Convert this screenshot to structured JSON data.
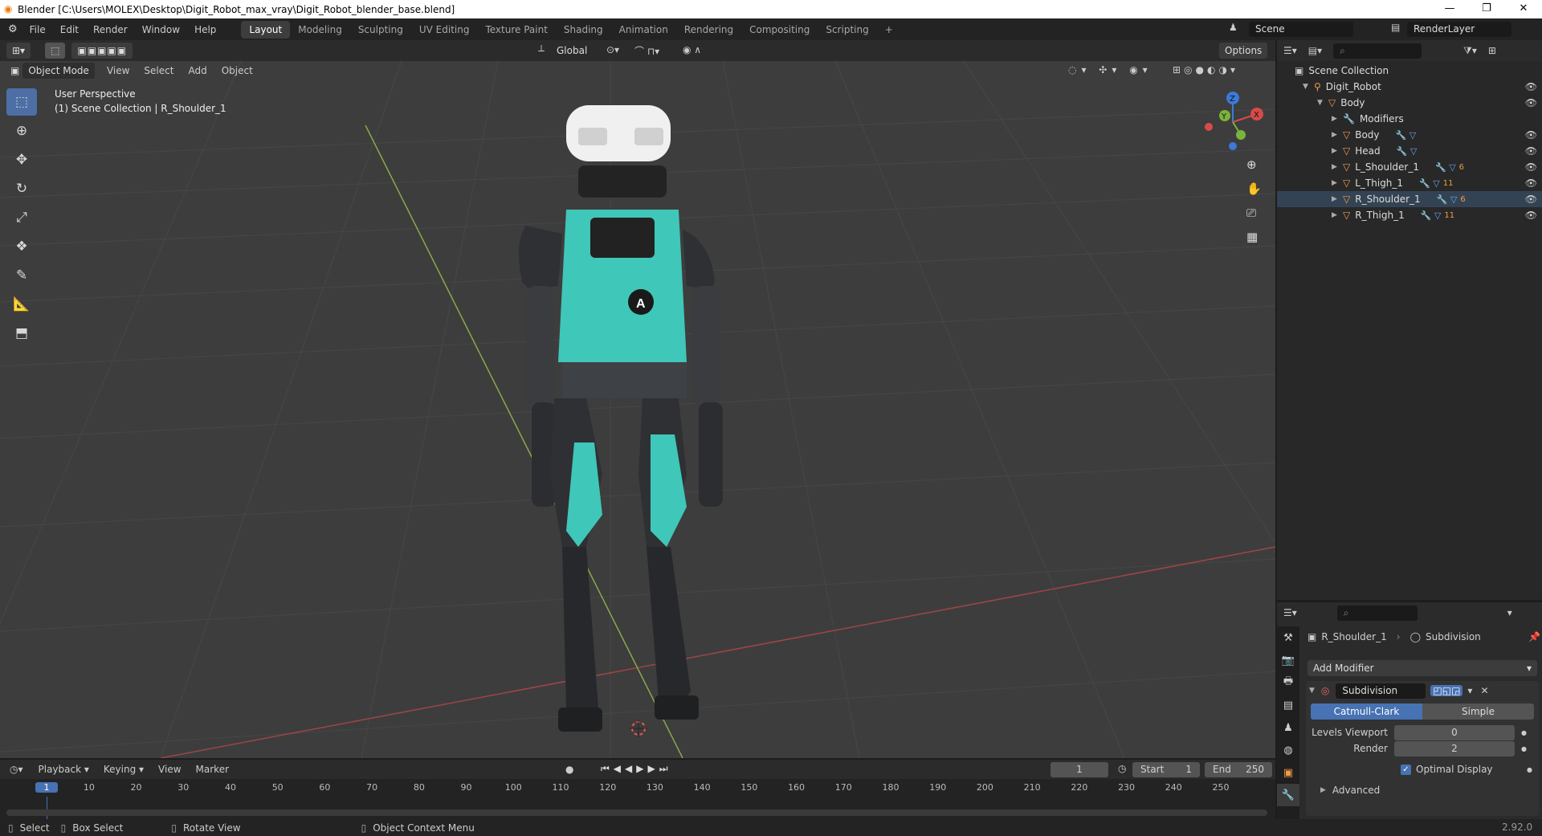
{
  "window": {
    "title": "Blender [C:\\Users\\MOLEX\\Desktop\\Digit_Robot_max_vray\\Digit_Robot_blender_base.blend]",
    "min": "—",
    "max": "❐",
    "close": "✕"
  },
  "menu": [
    "File",
    "Edit",
    "Render",
    "Window",
    "Help"
  ],
  "workspaces": [
    "Layout",
    "Modeling",
    "Sculpting",
    "UV Editing",
    "Texture Paint",
    "Shading",
    "Animation",
    "Rendering",
    "Compositing",
    "Scripting"
  ],
  "plus": "+",
  "scene": "Scene",
  "renderlayer": "RenderLayer",
  "header": {
    "transform": "Global",
    "options": "Options"
  },
  "vpmenu": {
    "mode": "Object Mode",
    "view": "View",
    "select": "Select",
    "add": "Add",
    "object": "Object"
  },
  "viewport": {
    "line1": "User Perspective",
    "line2": "(1) Scene Collection | R_Shoulder_1",
    "logo": "A"
  },
  "gizmo": {
    "x": "X",
    "y": "Y",
    "z": "Z"
  },
  "outliner": {
    "root": "Scene Collection",
    "items": [
      {
        "label": "Digit_Robot",
        "level": 1,
        "icon": "object"
      },
      {
        "label": "Body",
        "level": 2,
        "icon": "mesh"
      },
      {
        "label": "Modifiers",
        "level": 3,
        "icon": "wrench"
      },
      {
        "label": "Body",
        "level": 3,
        "icon": "mesh"
      },
      {
        "label": "Head",
        "level": 3,
        "icon": "mesh"
      },
      {
        "label": "L_Shoulder_1",
        "level": 3,
        "icon": "mesh",
        "badge": "6"
      },
      {
        "label": "L_Thigh_1",
        "level": 3,
        "icon": "mesh",
        "badge": "11"
      },
      {
        "label": "R_Shoulder_1",
        "level": 3,
        "icon": "mesh",
        "badge": "6"
      },
      {
        "label": "R_Thigh_1",
        "level": 3,
        "icon": "mesh",
        "badge": "11"
      }
    ]
  },
  "props": {
    "object": "R_Shoulder_1",
    "modifier": "Subdivision",
    "add_modifier": "Add Modifier",
    "mod_name": "Subdivision",
    "catmull": "Catmull-Clark",
    "simple": "Simple",
    "levels_label": "Levels Viewport",
    "levels_value": "0",
    "render_label": "Render",
    "render_value": "2",
    "optimal": "Optimal Display",
    "advanced": "Advanced"
  },
  "timeline": {
    "playback": "Playback",
    "keying": "Keying",
    "view": "View",
    "marker": "Marker",
    "current": "1",
    "start_label": "Start",
    "start": "1",
    "end_label": "End",
    "end": "250",
    "ticks": [
      "1",
      "10",
      "20",
      "30",
      "40",
      "50",
      "60",
      "70",
      "80",
      "90",
      "100",
      "110",
      "120",
      "130",
      "140",
      "150",
      "160",
      "170",
      "180",
      "190",
      "200",
      "210",
      "220",
      "230",
      "240",
      "250"
    ]
  },
  "status": {
    "select": "Select",
    "box": "Box Select",
    "rotate": "Rotate View",
    "context": "Object Context Menu",
    "version": "2.92.0"
  },
  "colors": {
    "accent": "#4772b3",
    "orange": "#f09b45",
    "teal": "#3fd1c1"
  }
}
